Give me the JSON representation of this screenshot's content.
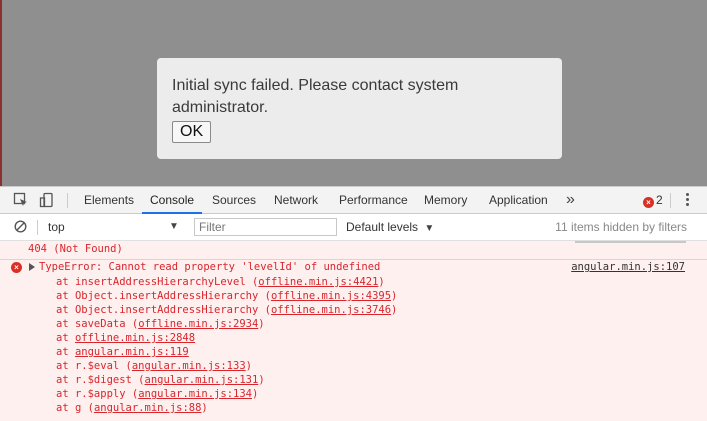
{
  "dialog": {
    "message": "Initial sync failed. Please contact system administrator.",
    "ok_label": "OK"
  },
  "devtools": {
    "tabs": [
      {
        "label": "Elements"
      },
      {
        "label": "Console",
        "active": true
      },
      {
        "label": "Sources"
      },
      {
        "label": "Network"
      },
      {
        "label": "Performance"
      },
      {
        "label": "Memory"
      },
      {
        "label": "Application"
      }
    ],
    "more_icon": "»",
    "error_count": "2",
    "filterbar": {
      "context": "top",
      "filter_placeholder": "Filter",
      "levels": "Default levels",
      "hidden_items": "11 items hidden by filters"
    }
  },
  "console": {
    "prev_message": "404 (Not Found)",
    "error": {
      "text": "TypeError: Cannot read property 'levelId' of undefined",
      "source": "angular.min.js:107",
      "stack": [
        {
          "prefix": "at insertAddressHierarchyLevel (",
          "link": "offline.min.js:4421",
          "suffix": ")"
        },
        {
          "prefix": "at Object.insertAddressHierarchy (",
          "link": "offline.min.js:4395",
          "suffix": ")"
        },
        {
          "prefix": "at Object.insertAddressHierarchy (",
          "link": "offline.min.js:3746",
          "suffix": ")"
        },
        {
          "prefix": "at saveData (",
          "link": "offline.min.js:2934",
          "suffix": ")"
        },
        {
          "prefix": "at ",
          "link": "offline.min.js:2848",
          "suffix": ""
        },
        {
          "prefix": "at ",
          "link": "angular.min.js:119",
          "suffix": ""
        },
        {
          "prefix": "at r.$eval (",
          "link": "angular.min.js:133",
          "suffix": ")"
        },
        {
          "prefix": "at r.$digest (",
          "link": "angular.min.js:131",
          "suffix": ")"
        },
        {
          "prefix": "at r.$apply (",
          "link": "angular.min.js:134",
          "suffix": ")"
        },
        {
          "prefix": "at g (",
          "link": "angular.min.js:88",
          "suffix": ")"
        }
      ]
    }
  },
  "colors": {
    "error_red": "#d8262c",
    "error_bg": "#fff0f0",
    "active_tab": "#1a73e8",
    "overlay_gray": "#8f8f8f"
  }
}
